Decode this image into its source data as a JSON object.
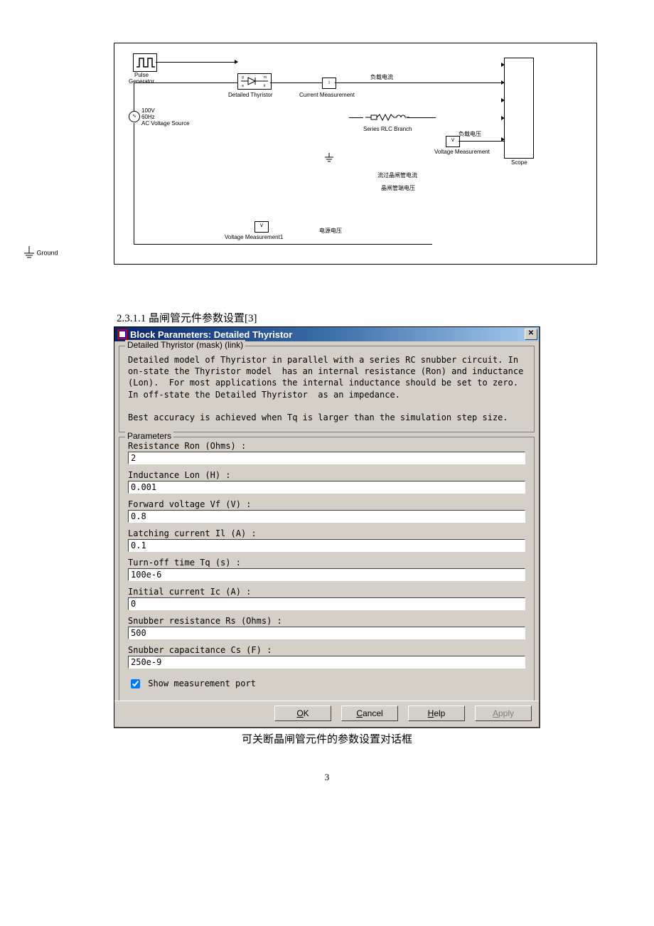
{
  "circuit": {
    "labels": {
      "pulse": "Pulse\nGenerator",
      "thyristor": "Detailed Thyristor",
      "curr_meas": "Current Measurement",
      "load_current": "负载电流",
      "src_line1": "100V",
      "src_line2": "60Hz",
      "src_line3": "AC Voltage Source",
      "rlc": "Series RLC Branch",
      "load_voltage": "负载电压",
      "volt_meas": "Voltage Measurement",
      "thy_current": "流过晶闸管电流",
      "thy_voltage": "晶闸管端电压",
      "volt_meas1": "Voltage Measurement1",
      "src_voltage": "电源电压",
      "scope": "Scope",
      "ground": "Ground"
    }
  },
  "section_head": "2.3.1.1 晶闸管元件参数设置[3]",
  "dialog": {
    "title": "Block Parameters: Detailed Thyristor",
    "group_mask": "Detailed Thyristor (mask) (link)",
    "description": "Detailed model of Thyristor in parallel with a series RC snubber circuit. In on-state the Thyristor model  has an internal resistance (Ron) and inductance (Lon).  For most applications the internal inductance should be set to zero. In off-state the Detailed Thyristor  as an impedance.\n\nBest accuracy is achieved when Tq is larger than the simulation step size.",
    "group_params": "Parameters",
    "params": [
      {
        "label": "Resistance Ron (Ohms) :",
        "value": "2"
      },
      {
        "label": "Inductance Lon (H) :",
        "value": "0.001"
      },
      {
        "label": "Forward voltage Vf (V) :",
        "value": "0.8"
      },
      {
        "label": "Latching current Il (A) :",
        "value": "0.1"
      },
      {
        "label": "Turn-off time Tq (s) :",
        "value": "100e-6"
      },
      {
        "label": "Initial current Ic (A) :",
        "value": "0"
      },
      {
        "label": "Snubber resistance Rs (Ohms) :",
        "value": "500"
      },
      {
        "label": "Snubber capacitance Cs (F) :",
        "value": "250e-9"
      }
    ],
    "checkbox_label": "Show measurement port",
    "checkbox_checked": true,
    "buttons": {
      "ok": "OK",
      "cancel": "Cancel",
      "help": "Help",
      "apply": "Apply"
    }
  },
  "caption": "可关断晶闸管元件的参数设置对话框",
  "pagenum": "3"
}
